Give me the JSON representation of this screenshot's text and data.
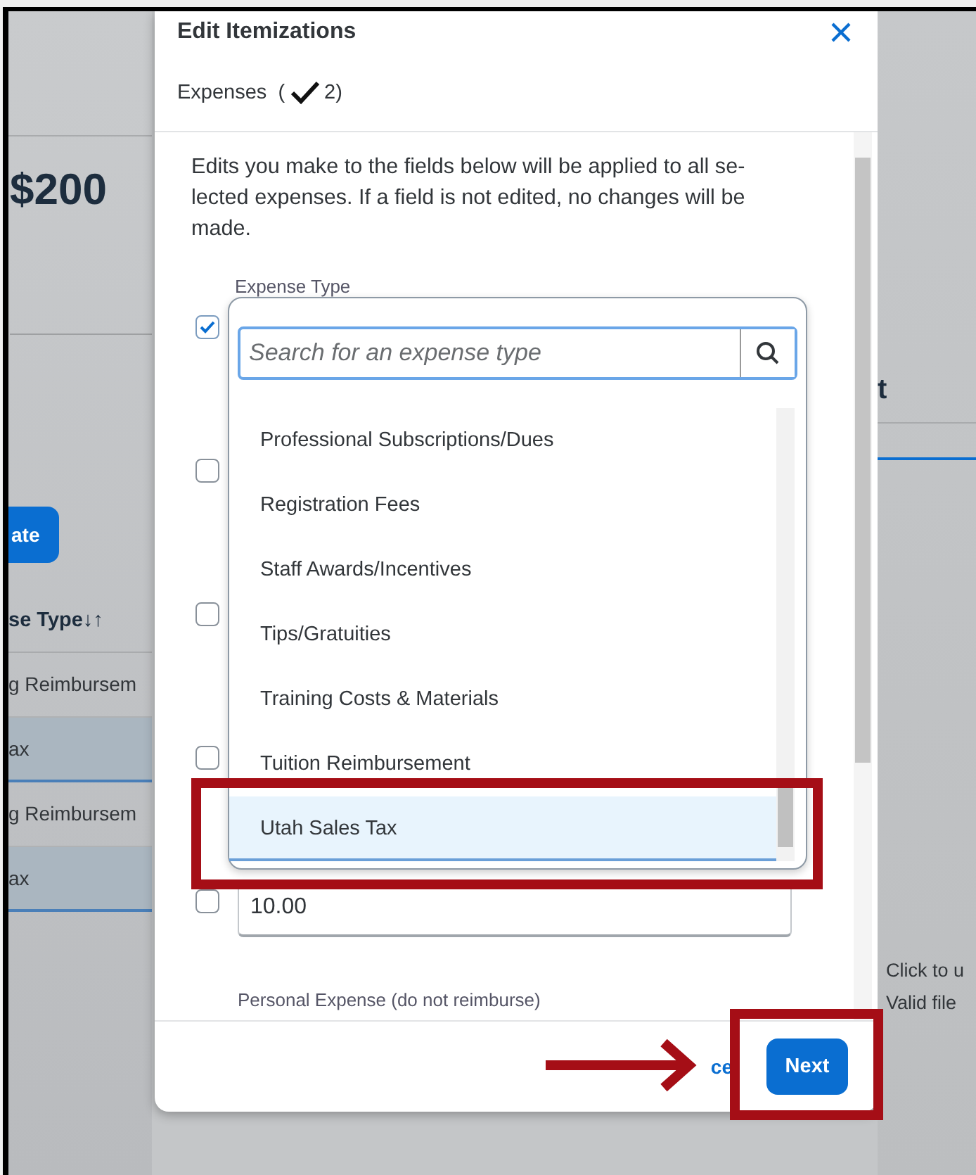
{
  "background": {
    "amount": "$200",
    "button": "ate",
    "column_header": "se Type↓↑",
    "rows": [
      {
        "text": "g Reimbursem",
        "selected": false
      },
      {
        "text": "ax",
        "selected": true
      },
      {
        "text": "g Reimbursem",
        "selected": false
      },
      {
        "text": "ax",
        "selected": true
      }
    ],
    "right_header": "t",
    "upload_hint": [
      "Click to u",
      "Valid file"
    ]
  },
  "dialog": {
    "title": "Edit Itemizations",
    "tab_label": "Expenses",
    "tab_open": "(",
    "tab_count": "2)",
    "intro": "Edits you make to the fields below will be applied to all se-lected expenses. If a field is not edited, no changes will be made.",
    "expense_type": {
      "label": "Expense Type",
      "checked": true,
      "placeholder": "Search for an expense type",
      "options": [
        {
          "label": "Professional Subscriptions/Dues",
          "selected": false
        },
        {
          "label": "Registration Fees",
          "selected": false
        },
        {
          "label": "Staff Awards/Incentives",
          "selected": false
        },
        {
          "label": "Tips/Gratuities",
          "selected": false
        },
        {
          "label": "Training Costs & Materials",
          "selected": false
        },
        {
          "label": "Tuition Reimbursement",
          "selected": false
        },
        {
          "label": "Utah Sales Tax",
          "selected": true
        }
      ]
    },
    "hidden_checkboxes": [
      {
        "checked": false
      },
      {
        "checked": false
      },
      {
        "checked": false
      }
    ],
    "amount": {
      "value": "10.00",
      "checked": false
    },
    "personal_label": "Personal Expense (do not reimburse)",
    "cancel": "ce",
    "next": "Next"
  }
}
